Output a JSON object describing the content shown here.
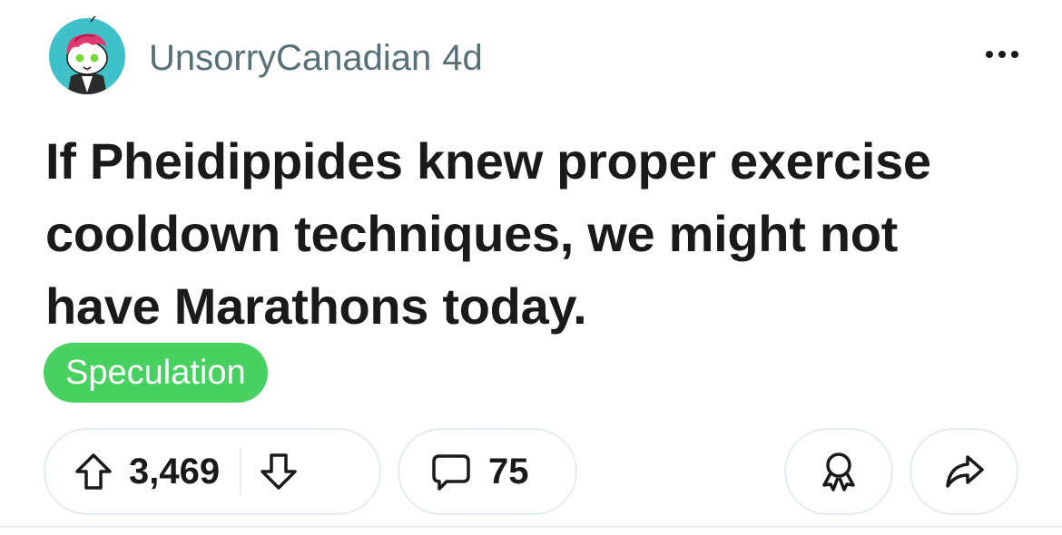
{
  "post": {
    "author": "UnsorryCanadian",
    "age": "4d",
    "title": "If Pheidippides knew proper exercise cooldown techniques, we might not have Marathons today.",
    "flair": "Speculation",
    "score": "3,469",
    "comments": "75"
  },
  "icons": {
    "avatar": "avatar-snoo-icon",
    "more": "more-options-icon",
    "upvote": "upvote-arrow-icon",
    "downvote": "downvote-arrow-icon",
    "comment": "comment-bubble-icon",
    "award": "award-icon",
    "share": "share-arrow-icon"
  },
  "colors": {
    "flair_bg": "#46d160",
    "meta_text": "#576f76",
    "title_text": "#1a1a1b",
    "pill_border": "#e5ebee",
    "avatar_bg": "#3fc1c9"
  }
}
